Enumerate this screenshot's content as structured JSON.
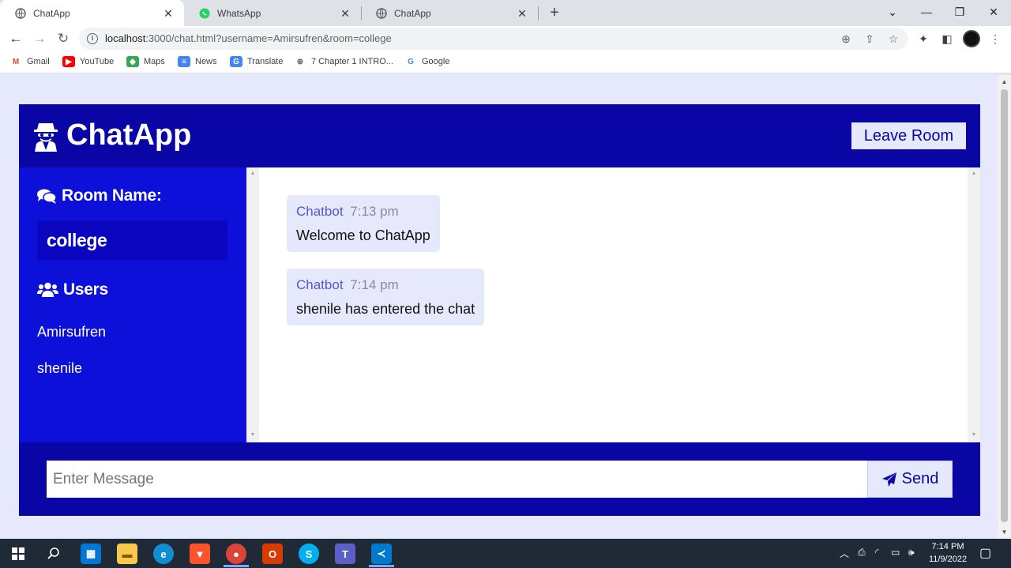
{
  "browser": {
    "tabs": [
      {
        "title": "ChatApp",
        "active": true
      },
      {
        "title": "WhatsApp",
        "active": false
      },
      {
        "title": "ChatApp",
        "active": false
      }
    ],
    "url_host": "localhost",
    "url_rest": ":3000/chat.html?username=Amirsufren&room=college",
    "bookmarks": [
      "Gmail",
      "YouTube",
      "Maps",
      "News",
      "Translate",
      "7 Chapter 1 INTRO...",
      "Google"
    ]
  },
  "app": {
    "title": "ChatApp",
    "leave_label": "Leave Room",
    "room_heading": "Room Name:",
    "room_name": "college",
    "users_heading": "Users",
    "users": [
      "Amirsufren",
      "shenile"
    ],
    "messages": [
      {
        "sender": "Chatbot",
        "time": "7:13 pm",
        "text": "Welcome to ChatApp"
      },
      {
        "sender": "Chatbot",
        "time": "7:14 pm",
        "text": "shenile has entered the chat"
      }
    ],
    "input_placeholder": "Enter Message",
    "send_label": "Send",
    "colors": {
      "primary": "#0a06a5",
      "sidebar": "#0c10d8",
      "light": "#e6e9fb"
    }
  },
  "taskbar": {
    "time": "7:14 PM",
    "date": "11/9/2022"
  }
}
